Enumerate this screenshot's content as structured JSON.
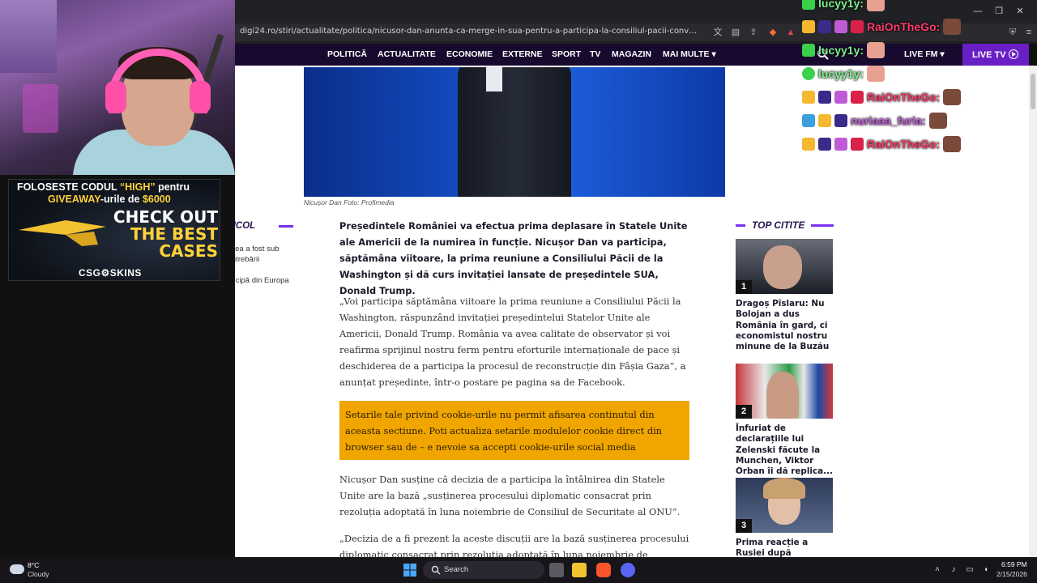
{
  "browser": {
    "url": "digi24.ro/stiri/actualitate/politica/nicusor-dan-anunta-ca-merge-in-sua-pentru-a-participa-la-consiliul-pacii-convocat-de-trump-romania-..."
  },
  "site_nav": {
    "items": [
      "POLITICĂ",
      "ACTUALITATE",
      "ECONOMIE",
      "EXTERNE",
      "SPORT",
      "TV",
      "MAGAZIN",
      "MAI MULTE"
    ],
    "live_fm": "LIVE FM",
    "live_tv": "LIVE TV"
  },
  "article": {
    "photo_caption": "Nicușor Dan Foto: Profimedia",
    "lead": "Președintele României va efectua prima deplasare în Statele Unite ale Americii de la numirea în funcție. Nicușor Dan va participa, săptămâna viitoare, la prima reuniune a Consiliului Păcii de la Washington și dă curs invitației lansate de președintele SUA, Donald Trump.",
    "para1": "„Voi participa săptămâna viitoare la prima reuniune a Consiliului Păcii la Washington, răspunzând invitației președintelui Statelor Unite ale Americii, Donald Trump. România va avea calitate de observator și voi reafirma sprijinul nostru ferm pentru eforturile internaționale de pace și deschiderea de a participa la procesul de reconstrucție din Fâșia Gaza”, a anunțat președinte, într-o postare pe pagina sa de Facebook.",
    "cookie_notice": "Setarile tale privind cookie-urile nu permit afisarea continutul din aceasta sectiune. Poti actualiza setarile modulelor cookie direct din browser sau de – e nevoie sa accepti cookie-urile social media",
    "para2": "Nicușor Dan susține că decizia de a participa la întâlnirea din Statele Unite are la bază „susținerea procesului diplomatic consacrat prin rezoluția adoptată în luna noiembrie de Consiliul de Securitate al ONU”.",
    "para3": "„Decizia de a fi prezent la aceste discuții are la bază susținerea procesului diplomatic consacrat prin rezoluția adoptată în luna noiembrie de Consiliul"
  },
  "toc": {
    "title": "ÎN ARTICOL",
    "items": [
      "Participarea a fost sub semnul întrebării",
      "Cine participă din Europa"
    ]
  },
  "top_read": {
    "title": "TOP CITITE",
    "items": [
      {
        "rank": "1",
        "headline": "Dragoș Pîslaru: Nu Bolojan a dus România în gard, ci economistul nostru minune de la Buzău"
      },
      {
        "rank": "2",
        "headline": "Înfuriat de declarațiile lui Zelenski făcute la Munchen, Viktor Orban îi dă replica..."
      },
      {
        "rank": "3",
        "headline": "Prima reacție a Rusiei după acuzațiile"
      }
    ]
  },
  "ad": {
    "line1_a": "FOLOSESTE CODUL ",
    "line1_b": "“HIGH”",
    "line1_c": " pentru",
    "line2_a": "GIVEAWAY",
    "line2_b": "-urile de ",
    "line2_c": "$6000",
    "big_1": "CHECK OUT",
    "big_2": "THE BEST",
    "big_3": "CASES",
    "brand": "CSG⚙SKINS"
  },
  "chat": [
    {
      "name": "lucyy1y:",
      "color": "#7cf08a"
    },
    {
      "name": "RaiOnTheGo:",
      "color": "#ff3b6b"
    },
    {
      "name": "lucyy1y:",
      "color": "#7cf08a"
    },
    {
      "name": "lucyy1y:",
      "color": "#7cf08a"
    },
    {
      "name": "RaiOnTheGo:",
      "color": "#ff3b6b"
    },
    {
      "name": "nuriaaa_furia:",
      "color": "#c05bd8"
    },
    {
      "name": "RaiOnTheGo:",
      "color": "#ff3b6b"
    }
  ],
  "taskbar": {
    "temp": "8°C",
    "weather": "Cloudy",
    "search": "Search",
    "time": "6:59 PM",
    "date": "2/15/2026"
  },
  "colors": {
    "accent_purple": "#7a2ff0",
    "live_tv": "#6a1fc6",
    "cookie_box": "#f0a500",
    "nav_bg": "#180a2e"
  }
}
